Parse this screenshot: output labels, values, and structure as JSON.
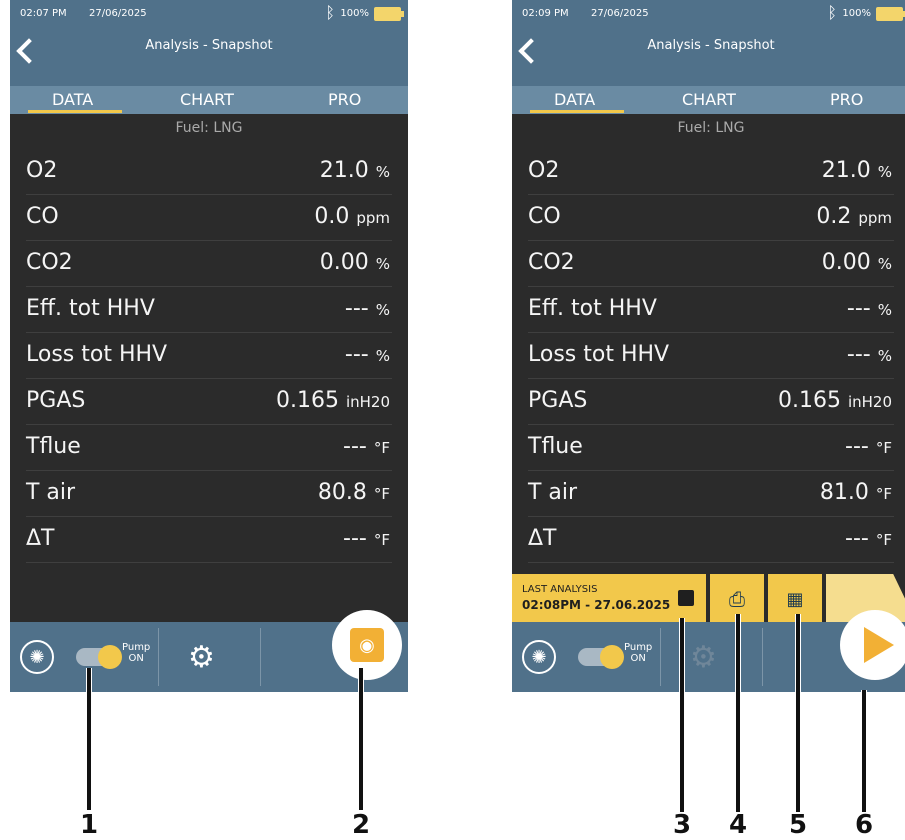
{
  "left": {
    "status": {
      "time": "02:07 PM",
      "date": "27/06/2025",
      "battery": "100%"
    },
    "title": "Analysis - Snapshot",
    "tabs": [
      "DATA",
      "CHART",
      "PRO"
    ],
    "fuel": "Fuel: LNG",
    "rows": [
      {
        "label": "O2",
        "value": "21.0",
        "unit": "%"
      },
      {
        "label": "CO",
        "value": "0.0",
        "unit": "ppm"
      },
      {
        "label": "CO2",
        "value": "0.00",
        "unit": "%"
      },
      {
        "label": "Eff. tot HHV",
        "value": "---",
        "unit": "%"
      },
      {
        "label": "Loss tot HHV",
        "value": "---",
        "unit": "%"
      },
      {
        "label": "PGAS",
        "value": "0.165",
        "unit": "inH20"
      },
      {
        "label": "Tflue",
        "value": "---",
        "unit": "°F"
      },
      {
        "label": "T air",
        "value": "80.8",
        "unit": "°F"
      },
      {
        "label": "ΔT",
        "value": "---",
        "unit": "°F"
      }
    ],
    "pump": {
      "line1": "Pump",
      "line2": "ON"
    }
  },
  "right": {
    "status": {
      "time": "02:09 PM",
      "date": "27/06/2025",
      "battery": "100%"
    },
    "title": "Analysis - Snapshot",
    "tabs": [
      "DATA",
      "CHART",
      "PRO"
    ],
    "fuel": "Fuel: LNG",
    "rows": [
      {
        "label": "O2",
        "value": "21.0",
        "unit": "%"
      },
      {
        "label": "CO",
        "value": "0.2",
        "unit": "ppm"
      },
      {
        "label": "CO2",
        "value": "0.00",
        "unit": "%"
      },
      {
        "label": "Eff. tot HHV",
        "value": "---",
        "unit": "%"
      },
      {
        "label": "Loss tot HHV",
        "value": "---",
        "unit": "%"
      },
      {
        "label": "PGAS",
        "value": "0.165",
        "unit": "inH20"
      },
      {
        "label": "Tflue",
        "value": "---",
        "unit": "°F"
      },
      {
        "label": "T air",
        "value": "81.0",
        "unit": "°F"
      },
      {
        "label": "ΔT",
        "value": "---",
        "unit": "°F"
      }
    ],
    "last_analysis": {
      "label": "LAST ANALYSIS",
      "value": "02:08PM - 27.06.2025"
    },
    "pump": {
      "line1": "Pump",
      "line2": "ON"
    }
  },
  "callouts": [
    "1",
    "2",
    "3",
    "4",
    "5",
    "6"
  ],
  "colors": {
    "accent": "#f2c84b",
    "header": "#50718a",
    "background": "#2b2b2b"
  }
}
